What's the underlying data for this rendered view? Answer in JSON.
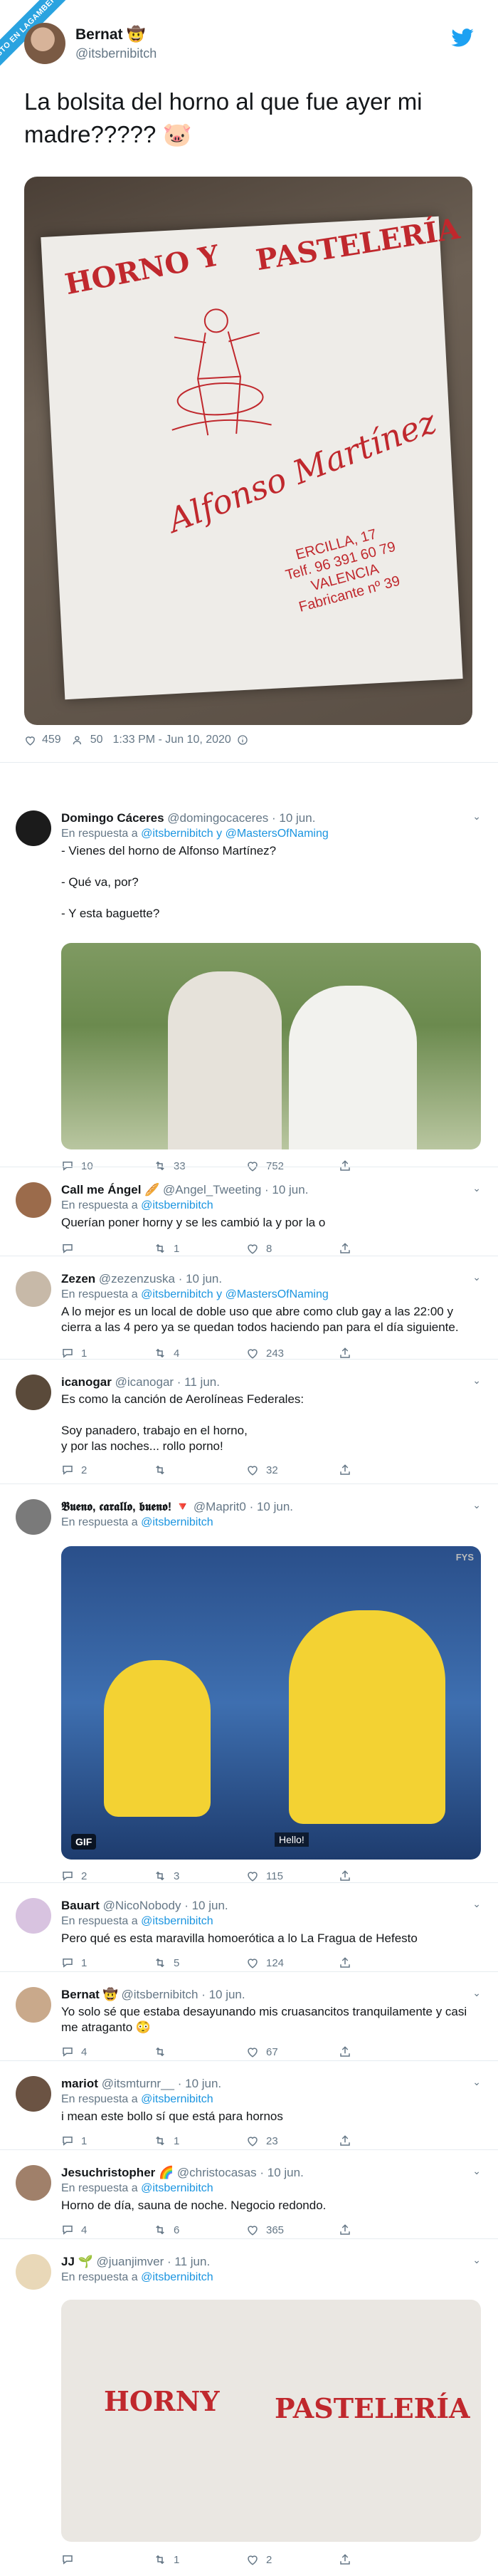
{
  "badge": {
    "text": "VISTO EN LAGAMBERRA"
  },
  "main_tweet": {
    "name": "Bernat 🤠",
    "handle": "@itsbernibitch",
    "text": "La bolsita del horno al que fue ayer mi madre????? 🐷",
    "bag": {
      "title_left": "HORNO Y",
      "title_right": "PASTELERÍA",
      "name": "Alfonso Martínez",
      "address": "ERCILLA, 17\nTelf. 96 391 60 79\nVALENCIA\nFabricante nº 39"
    },
    "likes": "459",
    "retweets": "50",
    "timestamp": "1:33 PM - Jun 10, 2020"
  },
  "replies": [
    {
      "name": "Domingo Cáceres",
      "handle": "@domingocaceres",
      "time": "· 10 jun.",
      "reply_to_prefix": "En respuesta a",
      "reply_to": "@itsbernibitch y @MastersOfNaming",
      "text": "- Vienes del horno de Alfonso Martínez?\n\n- Qué va, por?\n\n- Y esta baguette?",
      "replies": "10",
      "retweets": "33",
      "likes": "752"
    },
    {
      "name": "Call me Ángel 🥖",
      "handle": "@Angel_Tweeting",
      "time": "· 10 jun.",
      "reply_to_prefix": "En respuesta a",
      "reply_to": "@itsbernibitch",
      "text": "Querían poner horny y se les cambió la y por la o",
      "replies": "",
      "retweets": "1",
      "likes": "8"
    },
    {
      "name": "Zezen",
      "handle": "@zezenzuska",
      "time": "· 10 jun.",
      "reply_to_prefix": "En respuesta a",
      "reply_to": "@itsbernibitch y @MastersOfNaming",
      "text": "A lo mejor es un local de doble uso que abre como club gay a las 22:00 y cierra a las 4 pero ya se quedan todos haciendo pan para el día siguiente.",
      "replies": "1",
      "retweets": "4",
      "likes": "243"
    },
    {
      "name": "icanogar",
      "handle": "@icanogar",
      "time": "· 11 jun.",
      "reply_to_prefix": "",
      "reply_to": "",
      "text": "Es como la canción de Aerolíneas Federales:\n\nSoy panadero, trabajo en el horno,\ny por las noches... rollo porno!",
      "replies": "2",
      "retweets": "",
      "likes": "32"
    },
    {
      "name": "𝕭𝖚𝖊𝖓𝖔, 𝖈𝖆𝖗𝖆𝖑𝖑𝖔, 𝖇𝖚𝖊𝖓𝖔! 🔻",
      "handle": "@Maprit0",
      "time": "· 10 jun.",
      "reply_to_prefix": "En respuesta a",
      "reply_to": "@itsbernibitch",
      "text": "",
      "gif_label": "GIF",
      "gif_caption": "Hello!",
      "gif_source": "FYS",
      "replies": "2",
      "retweets": "3",
      "likes": "115"
    },
    {
      "name": "Bauart",
      "handle": "@NicoNobody",
      "time": "· 10 jun.",
      "reply_to_prefix": "En respuesta a",
      "reply_to": "@itsbernibitch",
      "text": "Pero qué es esta maravilla homoerótica a lo La Fragua de Hefesto",
      "replies": "1",
      "retweets": "5",
      "likes": "124"
    },
    {
      "name": "Bernat 🤠",
      "handle": "@itsbernibitch",
      "time": "· 10 jun.",
      "reply_to_prefix": "",
      "reply_to": "",
      "text": "Yo solo sé que estaba desayunando mis cruasancitos tranquilamente y casi me atraganto 😳",
      "replies": "4",
      "retweets": "",
      "likes": "67"
    },
    {
      "name": "mariot",
      "handle": "@itsmturnr__",
      "time": "· 10 jun.",
      "reply_to_prefix": "En respuesta a",
      "reply_to": "@itsbernibitch",
      "text": "i mean este bollo sí que está para hornos",
      "replies": "1",
      "retweets": "1",
      "likes": "23"
    },
    {
      "name": "Jesuchristopher 🌈",
      "handle": "@christocasas",
      "time": "· 10 jun.",
      "reply_to_prefix": "En respuesta a",
      "reply_to": "@itsbernibitch",
      "text": "Horno de día, sauna de noche. Negocio redondo.",
      "replies": "4",
      "retweets": "6",
      "likes": "365"
    },
    {
      "name": "JJ 🌱",
      "handle": "@juanjimver",
      "time": "· 11 jun.",
      "reply_to_prefix": "En respuesta a",
      "reply_to": "@itsbernibitch",
      "text": "",
      "bag_left": "HORNY",
      "bag_right": "PASTELERÍA",
      "replies": "",
      "retweets": "1",
      "likes": "2"
    }
  ]
}
